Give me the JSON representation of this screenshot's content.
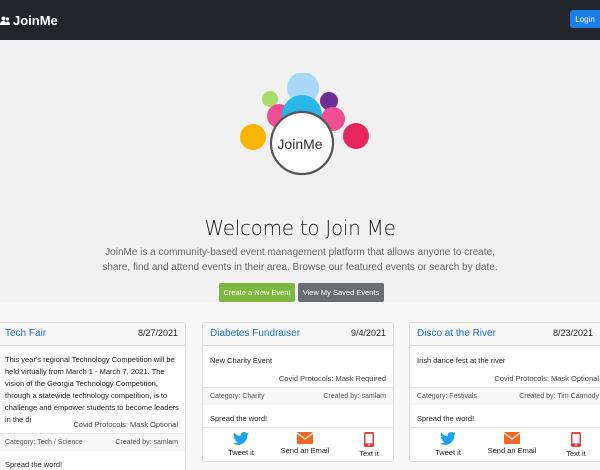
{
  "navbar": {
    "brand": "JoinMe",
    "login_label": "Login"
  },
  "hero": {
    "logo_text": "JoinMe",
    "title": "Welcome to Join Me",
    "description": "JoinMe is a community-based event management platform that allows anyone to create, share, find and attend events in their area. Browse our featured events or search by date.",
    "create_label": "Create a New Event",
    "saved_label": "View My Saved Events"
  },
  "colors": {
    "navbar": "#212529",
    "login": "#1b7ee8",
    "create": "#7cb73f",
    "saved": "#6a6e73",
    "link": "#1b6fd1",
    "twitter": "#1da1f2",
    "email": "#f26522",
    "text": "#e53935"
  },
  "cards": [
    {
      "title": "Tech Fair",
      "date": "8/27/2021",
      "description": "This year's regional Technology Competition will be held virtually from March 1 - March 7, 2021. The vision of the Georgia Technology Competition, through a statewide technology competition, is to challenge and empower students to become leaders in the di",
      "covid": "Covid Protocols: Mask Optional",
      "category": "Category: Tech / Science",
      "created_by": "Created by: samlam",
      "spread": "Spread the word!"
    },
    {
      "title": "Diabetes Fundraiser",
      "date": "9/4/2021",
      "description": "New Charity Event",
      "covid": "Covid Protocols: Mask Required",
      "category": "Category: Charity",
      "created_by": "Created by: samlam",
      "spread": "Spread the word!",
      "share": {
        "tweet": "Tweet it",
        "email": "Send an Email",
        "text": "Text it"
      }
    },
    {
      "title": "Disco at the River",
      "date": "8/23/2021",
      "description": "Irish dance fest at the river",
      "covid": "Covid Protocols: Mask Optional",
      "category": "Category: Festivals",
      "created_by": "Created by: Tim Carmody",
      "spread": "Spread the word!",
      "share": {
        "tweet": "Tweet it",
        "email": "Send an Email",
        "text": "Text it"
      }
    }
  ]
}
